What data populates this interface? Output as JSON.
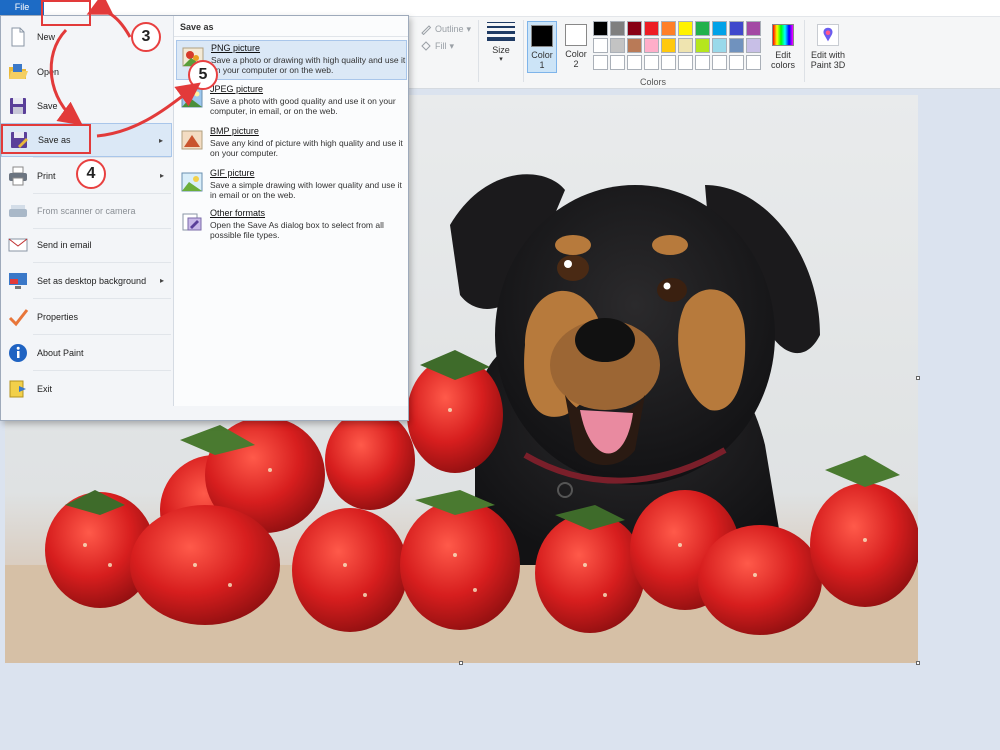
{
  "ribbon": {
    "file_tab": "File",
    "outline_label": "Outline",
    "fill_label": "Fill",
    "size_label": "Size",
    "color1_label": "Color 1",
    "color2_label": "Color 2",
    "colors_group_label": "Colors",
    "edit_colors_label": "Edit colors",
    "paint3d_label": "Edit with Paint 3D",
    "color1_value": "#000000",
    "color2_value": "#ffffff",
    "palette": [
      "#000000",
      "#7f7f7f",
      "#880015",
      "#ed1c24",
      "#ff7f27",
      "#fff200",
      "#22b14c",
      "#00a2e8",
      "#3f48cc",
      "#a349a4",
      "#ffffff",
      "#c3c3c3",
      "#b97a57",
      "#ffaec9",
      "#ffc90e",
      "#efe4b0",
      "#b5e61d",
      "#99d9ea",
      "#7092be",
      "#c8bfe7",
      "#ffffff",
      "#ffffff",
      "#ffffff",
      "#ffffff",
      "#ffffff",
      "#ffffff",
      "#ffffff",
      "#ffffff",
      "#ffffff",
      "#ffffff"
    ]
  },
  "file_menu": {
    "items": [
      {
        "label": "New",
        "icon": "new-document-icon"
      },
      {
        "label": "Open",
        "icon": "open-folder-icon"
      },
      {
        "label": "Save",
        "icon": "floppy-disk-icon"
      },
      {
        "label": "Save as",
        "icon": "save-as-icon",
        "has_submenu": true,
        "highlighted": true
      },
      {
        "label": "Print",
        "icon": "printer-icon",
        "has_submenu": true
      },
      {
        "label": "From scanner or camera",
        "icon": "scanner-icon",
        "disabled": true
      },
      {
        "label": "Send in email",
        "icon": "email-icon"
      },
      {
        "label": "Set as desktop background",
        "icon": "desktop-background-icon",
        "has_submenu": true
      },
      {
        "label": "Properties",
        "icon": "checkmark-icon"
      },
      {
        "label": "About Paint",
        "icon": "info-icon"
      },
      {
        "label": "Exit",
        "icon": "exit-icon"
      }
    ],
    "submenu": {
      "header": "Save as",
      "items": [
        {
          "title": "PNG picture",
          "desc": "Save a photo or drawing with high quality and use it on your computer or on the web.",
          "icon": "png-picture-icon",
          "highlighted": true
        },
        {
          "title": "JPEG picture",
          "desc": "Save a photo with good quality and use it on your computer, in email, or on the web.",
          "icon": "jpeg-picture-icon"
        },
        {
          "title": "BMP picture",
          "desc": "Save any kind of picture with high quality and use it on your computer.",
          "icon": "bmp-picture-icon"
        },
        {
          "title": "GIF picture",
          "desc": "Save a simple drawing with lower quality and use it in email or on the web.",
          "icon": "gif-picture-icon"
        },
        {
          "title": "Other formats",
          "desc": "Open the Save As dialog box to select from all possible file types.",
          "icon": "other-formats-icon"
        }
      ]
    }
  },
  "annotations": {
    "step3": "3",
    "step4": "4",
    "step5": "5",
    "accent_color": "#e23a3a"
  }
}
